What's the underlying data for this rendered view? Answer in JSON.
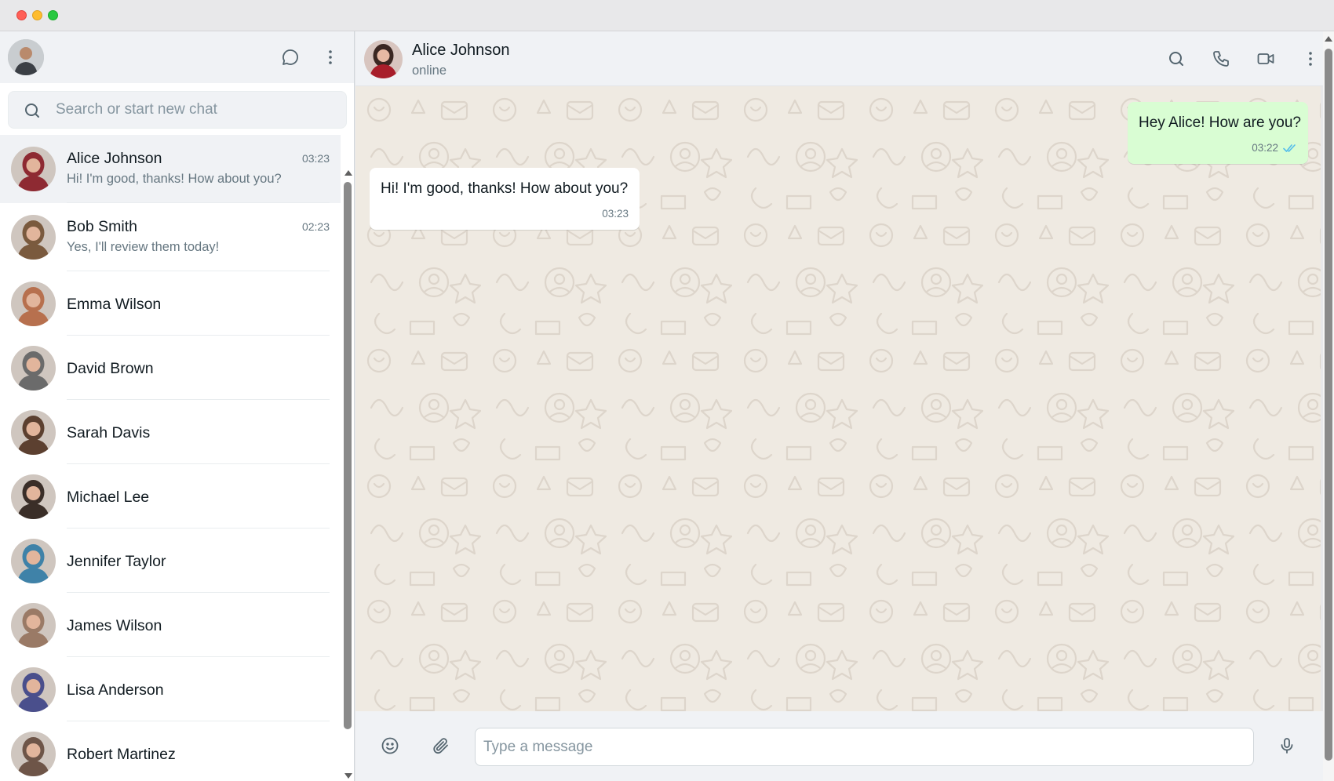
{
  "window": {
    "controls": [
      "close",
      "minimize",
      "zoom"
    ]
  },
  "sidebar": {
    "header_icons": [
      "new-chat-icon",
      "menu-dots-icon"
    ],
    "search": {
      "placeholder": "Search or start new chat"
    },
    "chats": [
      {
        "name": "Alice Johnson",
        "time": "03:23",
        "preview": "Hi! I'm good, thanks! How about you?",
        "active": true,
        "avatar_color": "#8e2a32"
      },
      {
        "name": "Bob Smith",
        "time": "02:23",
        "preview": "Yes, I'll review them today!",
        "active": false,
        "avatar_color": "#7a5a3e"
      },
      {
        "name": "Emma Wilson",
        "time": "",
        "preview": "",
        "active": false,
        "avatar_color": "#b7704e"
      },
      {
        "name": "David Brown",
        "time": "",
        "preview": "",
        "active": false,
        "avatar_color": "#6b6b6b"
      },
      {
        "name": "Sarah Davis",
        "time": "",
        "preview": "",
        "active": false,
        "avatar_color": "#5c4030"
      },
      {
        "name": "Michael Lee",
        "time": "",
        "preview": "",
        "active": false,
        "avatar_color": "#3a2e28"
      },
      {
        "name": "Jennifer Taylor",
        "time": "",
        "preview": "",
        "active": false,
        "avatar_color": "#3f82a8"
      },
      {
        "name": "James Wilson",
        "time": "",
        "preview": "",
        "active": false,
        "avatar_color": "#9a7a66"
      },
      {
        "name": "Lisa Anderson",
        "time": "",
        "preview": "",
        "active": false,
        "avatar_color": "#4a4f8c"
      },
      {
        "name": "Robert Martinez",
        "time": "",
        "preview": "",
        "active": false,
        "avatar_color": "#6e5548"
      }
    ]
  },
  "chat": {
    "contact_name": "Alice Johnson",
    "contact_status": "online",
    "header_icons": [
      "search-icon",
      "phone-icon",
      "video-icon",
      "menu-dots-icon"
    ],
    "messages": [
      {
        "direction": "out",
        "text": "Hey Alice! How are you?",
        "time": "03:22",
        "status": "read"
      },
      {
        "direction": "in",
        "text": "Hi! I'm good, thanks! How about you?",
        "time": "03:23"
      }
    ],
    "composer": {
      "placeholder": "Type a message",
      "icons": [
        "emoji-icon",
        "attach-icon",
        "microphone-icon"
      ]
    }
  },
  "colors": {
    "outgoing_bubble": "#d9fdd3",
    "incoming_bubble": "#ffffff",
    "wallpaper": "#efeae2",
    "panel": "#f0f2f5",
    "read_ticks": "#53bdeb"
  }
}
